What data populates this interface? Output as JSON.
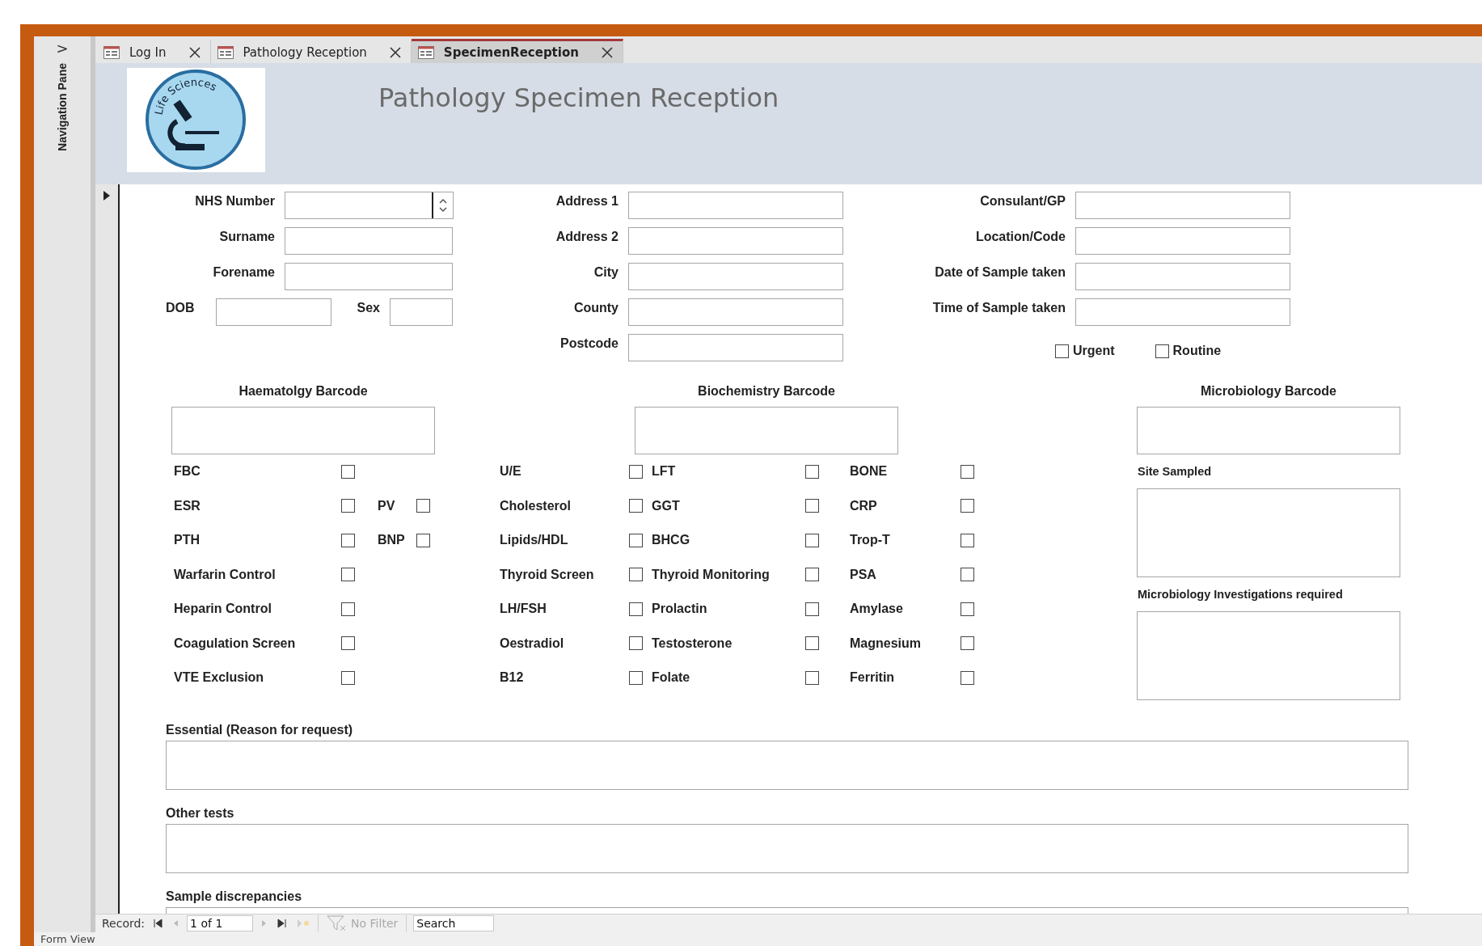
{
  "nav_pane": {
    "label": "Navigation Pane",
    "toggle": ">"
  },
  "tabs": [
    {
      "label": "Log In",
      "selected": false
    },
    {
      "label": "Pathology Reception",
      "selected": false
    },
    {
      "label": "SpecimenReception",
      "selected": true
    }
  ],
  "header": {
    "logo_text": "Life Sciences",
    "title": "Pathology Specimen Reception"
  },
  "patient_fields": [
    {
      "label": "NHS Number",
      "kind": "spin"
    },
    {
      "label": "Surname",
      "kind": "text"
    },
    {
      "label": "Forename",
      "kind": "text"
    }
  ],
  "dob_row": [
    {
      "label": "DOB"
    },
    {
      "label": "Sex"
    }
  ],
  "address_fields": [
    {
      "label": "Address 1"
    },
    {
      "label": "Address 2"
    },
    {
      "label": "City"
    },
    {
      "label": "County"
    },
    {
      "label": "Postcode"
    }
  ],
  "request_fields": [
    {
      "label": "Consulant/GP"
    },
    {
      "label": "Location/Code"
    },
    {
      "label": "Date of Sample taken"
    },
    {
      "label": "Time of Sample taken"
    }
  ],
  "priority": [
    {
      "label": "Urgent",
      "checked": false
    },
    {
      "label": "Routine",
      "checked": false
    }
  ],
  "barcodes": [
    {
      "label": "Haematolgy Barcode"
    },
    {
      "label": "Biochemistry Barcode"
    },
    {
      "label": "Microbiology Barcode"
    }
  ],
  "haematology_rows": [
    {
      "tests": [
        {
          "label": "FBC",
          "checked": false
        }
      ]
    },
    {
      "tests": [
        {
          "label": "ESR",
          "checked": false
        },
        {
          "label": "PV",
          "checked": false
        }
      ]
    },
    {
      "tests": [
        {
          "label": "PTH",
          "checked": false
        },
        {
          "label": "BNP",
          "checked": false
        }
      ]
    },
    {
      "tests": [
        {
          "label": "Warfarin Control",
          "checked": false
        }
      ]
    },
    {
      "tests": [
        {
          "label": "Heparin Control",
          "checked": false
        }
      ]
    },
    {
      "tests": [
        {
          "label": "Coagulation Screen",
          "checked": false
        }
      ]
    },
    {
      "tests": [
        {
          "label": "VTE Exclusion",
          "checked": false
        }
      ]
    }
  ],
  "biochemistry_rows": [
    {
      "tests": [
        {
          "label": "U/E",
          "checked": false
        },
        {
          "label": "LFT",
          "checked": false
        },
        {
          "label": "BONE",
          "checked": false
        }
      ]
    },
    {
      "tests": [
        {
          "label": "Cholesterol",
          "checked": false
        },
        {
          "label": "GGT",
          "checked": false
        },
        {
          "label": "CRP",
          "checked": false
        }
      ]
    },
    {
      "tests": [
        {
          "label": "Lipids/HDL",
          "checked": false
        },
        {
          "label": "BHCG",
          "checked": false
        },
        {
          "label": "Trop-T",
          "checked": false
        }
      ]
    },
    {
      "tests": [
        {
          "label": "Thyroid Screen",
          "checked": false
        },
        {
          "label": "Thyroid Monitoring",
          "checked": false
        },
        {
          "label": "PSA",
          "checked": false
        }
      ]
    },
    {
      "tests": [
        {
          "label": "LH/FSH",
          "checked": false
        },
        {
          "label": "Prolactin",
          "checked": false
        },
        {
          "label": "Amylase",
          "checked": false
        }
      ]
    },
    {
      "tests": [
        {
          "label": "Oestradiol",
          "checked": false
        },
        {
          "label": "Testosterone",
          "checked": false
        },
        {
          "label": "Magnesium",
          "checked": false
        }
      ]
    },
    {
      "tests": [
        {
          "label": "B12",
          "checked": false
        },
        {
          "label": "Folate",
          "checked": false
        },
        {
          "label": "Ferritin",
          "checked": false
        }
      ]
    }
  ],
  "microbiology": {
    "site_label": "Site Sampled",
    "investigations_label": "Microbiology Investigations required"
  },
  "notes": [
    {
      "label": "Essential (Reason for request)"
    },
    {
      "label": "Other tests"
    },
    {
      "label": "Sample discrepancies"
    }
  ],
  "record_nav": {
    "label": "Record:",
    "position": "1 of 1",
    "filter": "No Filter",
    "search": "Search"
  },
  "status_bar": "Form View"
}
